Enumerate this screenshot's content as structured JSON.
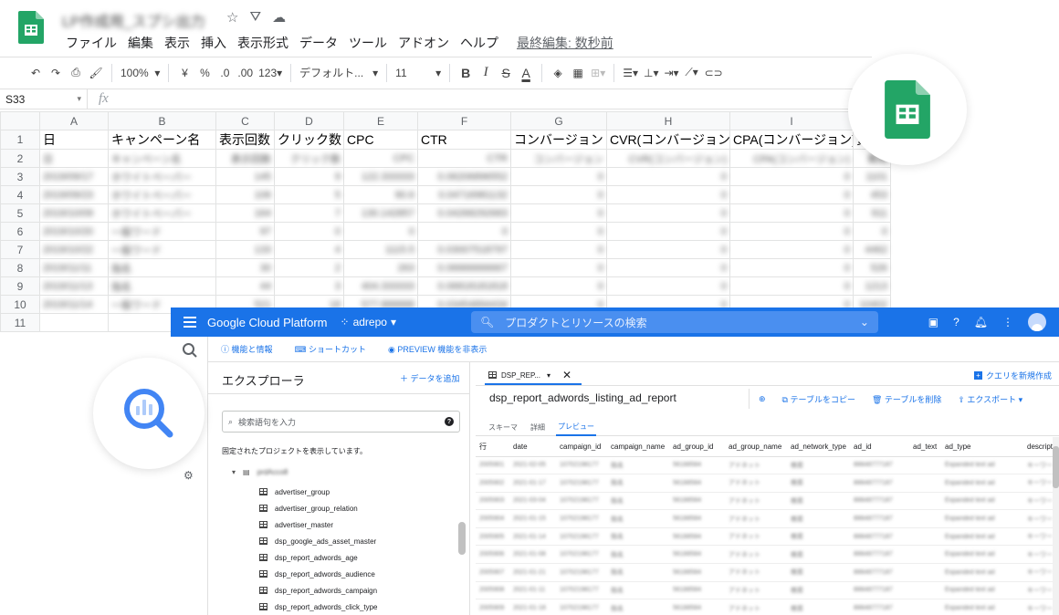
{
  "sheets": {
    "doc_title": "LP作成用_スプシ出力",
    "menu": [
      "ファイル",
      "編集",
      "表示",
      "挿入",
      "表示形式",
      "データ",
      "ツール",
      "アドオン",
      "ヘルプ"
    ],
    "last_edit": "最終編集: 数秒前",
    "toolbar": {
      "zoom": "100%",
      "currency": "¥",
      "percent": "%",
      "dec_decrease": ".0",
      "dec_increase": ".00",
      "number_format": "123",
      "font": "デフォルト...",
      "font_size": "11",
      "bold": "B",
      "italic": "I",
      "strike": "S",
      "text_color": "A"
    },
    "name_box": "S33",
    "fx": "fx",
    "columns": [
      "A",
      "B",
      "C",
      "D",
      "E",
      "F",
      "G",
      "H",
      "I"
    ],
    "rows": [
      {
        "n": "1",
        "cells": [
          "日",
          "キャンペーン名",
          "表示回数",
          "クリック数",
          "CPC",
          "CTR",
          "コンバージョン",
          "CVR(コンバージョン)",
          "CPA(コンバージョン)",
          "費"
        ]
      },
      {
        "n": "2",
        "cells": [
          "日",
          "キャンペーン名",
          "表示回数",
          "クリック数",
          "CPC",
          "CTR",
          "コンバージョン",
          "CVR(コンバージョン)",
          "CPA(コンバージョン)",
          "費用"
        ]
      },
      {
        "n": "3",
        "cells": [
          "2019/09/17",
          "ホワイトペーパー",
          "145",
          "9",
          "122.333333",
          "0.06206896552",
          "0",
          "0",
          "0",
          "1101"
        ]
      },
      {
        "n": "4",
        "cells": [
          "2019/09/23",
          "ホワイトペーパー",
          "106",
          "5",
          "90.6",
          "0.04716981132",
          "0",
          "0",
          "0",
          "453"
        ]
      },
      {
        "n": "5",
        "cells": [
          "2019/10/09",
          "ホワイトペーパー",
          "164",
          "7",
          "130.142857",
          "0.04268292683",
          "0",
          "0",
          "0",
          "911"
        ]
      },
      {
        "n": "6",
        "cells": [
          "2019/10/20",
          "一般ワード",
          "97",
          "0",
          "0",
          "0",
          "0",
          "0",
          "0",
          "0"
        ]
      },
      {
        "n": "7",
        "cells": [
          "2019/10/22",
          "一般ワード",
          "133",
          "4",
          "1115.5",
          "0.03007518797",
          "0",
          "0",
          "0",
          "4462"
        ]
      },
      {
        "n": "8",
        "cells": [
          "2019/11/11",
          "指名",
          "30",
          "2",
          "263",
          "0.06666666667",
          "0",
          "0",
          "0",
          "526"
        ]
      },
      {
        "n": "9",
        "cells": [
          "2019/11/13",
          "指名",
          "44",
          "3",
          "404.333333",
          "0.06818181818",
          "0",
          "0",
          "0",
          "1213"
        ]
      },
      {
        "n": "10",
        "cells": [
          "2019/11/14",
          "一般ワード",
          "521",
          "18",
          "577.888888",
          "0.03454894434",
          "0",
          "0",
          "0",
          "10402"
        ]
      },
      {
        "n": "11",
        "cells": [
          "",
          "",
          "",
          "",
          "",
          "",
          "",
          "",
          "",
          ""
        ]
      }
    ]
  },
  "gcp": {
    "brand": "Google Cloud Platform",
    "project": "adrepo",
    "search_placeholder": "プロダクトとリソースの検索",
    "subbar": [
      "機能と情報",
      "ショートカット",
      "PREVIEW 機能を非表示"
    ],
    "explorer_title": "エクスプローラ",
    "add_data": "データを追加",
    "search_terms_placeholder": "検索語句を入力",
    "help": "?",
    "pinned_text": "固定されたプロジェクトを表示しています。",
    "project_node": "prdAcco8",
    "tables": [
      "advertiser_group",
      "advertiser_group_relation",
      "advertiser_master",
      "dsp_google_ads_asset_master",
      "dsp_report_adwords_age",
      "dsp_report_adwords_audience",
      "dsp_report_adwords_campaign",
      "dsp_report_adwords_click_type"
    ],
    "tab_label": "DSP_REP...",
    "new_query": "クエリを新規作成",
    "table_name": "dsp_report_adwords_listing_ad_report",
    "actions": [
      "テーブルをコピー",
      "テーブルを削除",
      "エクスポート"
    ],
    "subtabs": [
      "スキーマ",
      "詳細",
      "プレビュー"
    ],
    "preview_columns": [
      "行",
      "date",
      "campaign_id",
      "campaign_name",
      "ad_group_id",
      "ad_group_name",
      "ad_network_type",
      "ad_id",
      "ad_text",
      "ad_type",
      "descripti"
    ],
    "preview_rows": [
      [
        "2005901",
        "2021-02-05",
        "10702198177",
        "指名",
        "56188584",
        "アドネット",
        "検索",
        "88848777187",
        "",
        "Expanded text ad",
        "キーワード"
      ],
      [
        "2005902",
        "2021-01-17",
        "10702198177",
        "指名",
        "56188584",
        "アドネット",
        "検索",
        "88848777187",
        "",
        "Expanded text ad",
        "キーワード"
      ],
      [
        "2005903",
        "2021-03-04",
        "10702198177",
        "指名",
        "56188584",
        "アドネット",
        "検索",
        "88848777187",
        "",
        "Expanded text ad",
        "キーワード"
      ],
      [
        "2005904",
        "2021-01-15",
        "10702198177",
        "指名",
        "56188584",
        "アドネット",
        "検索",
        "88848777187",
        "",
        "Expanded text ad",
        "キーワード"
      ],
      [
        "2005905",
        "2021-01-14",
        "10702198177",
        "指名",
        "56188584",
        "アドネット",
        "検索",
        "88848777187",
        "",
        "Expanded text ad",
        "キーワード"
      ],
      [
        "2005906",
        "2021-01-08",
        "10702198177",
        "指名",
        "56188584",
        "アドネット",
        "検索",
        "88848777187",
        "",
        "Expanded text ad",
        "キーワード"
      ],
      [
        "2005907",
        "2021-01-21",
        "10702198177",
        "指名",
        "56188584",
        "アドネット",
        "検索",
        "88848777187",
        "",
        "Expanded text ad",
        "キーワード"
      ],
      [
        "2005908",
        "2021-01-11",
        "10702198177",
        "指名",
        "56188584",
        "アドネット",
        "検索",
        "88848777187",
        "",
        "Expanded text ad",
        "キーワード"
      ],
      [
        "2005909",
        "2021-01-18",
        "10702198177",
        "指名",
        "56188584",
        "アドネット",
        "検索",
        "88848777187",
        "",
        "Expanded text ad",
        "キーワード"
      ],
      [
        "2005910",
        "2021-01-24",
        "10702198177",
        "指名",
        "56188584",
        "アドネット",
        "検索",
        "88848777187",
        "",
        "Expanded text ad",
        "キーワード"
      ]
    ]
  },
  "colors": {
    "sheets_green": "#23a566",
    "gcp_blue": "#1a73e8",
    "bq_blue": "#4285f4"
  }
}
